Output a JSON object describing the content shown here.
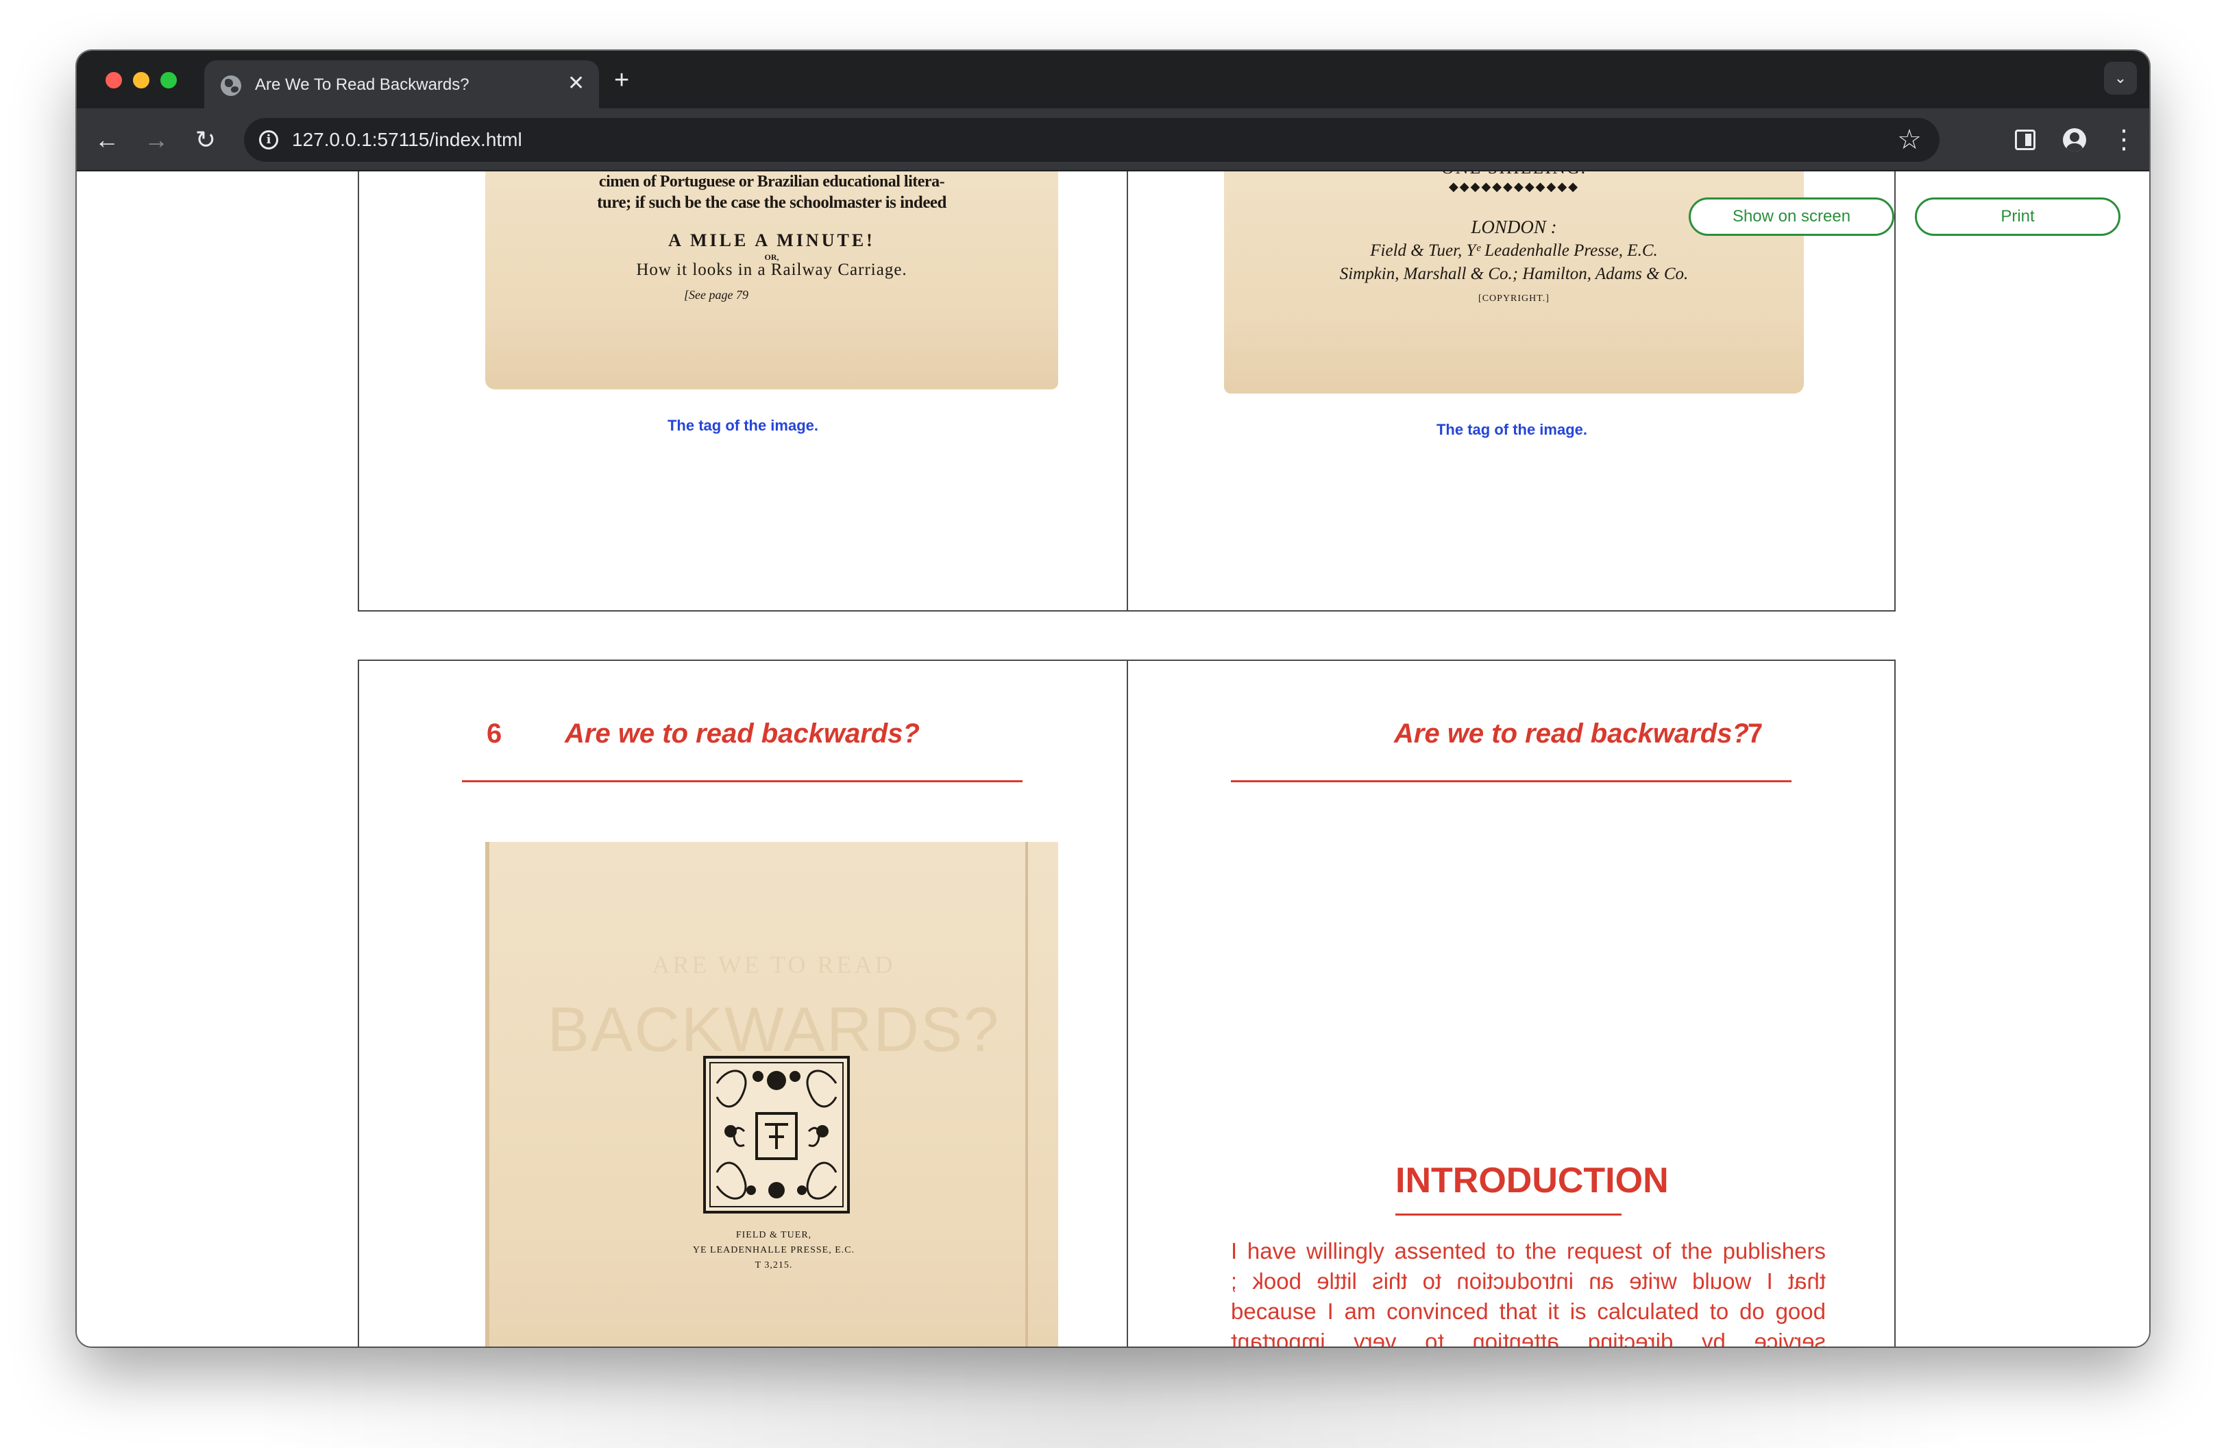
{
  "browser": {
    "tab_title": "Are We To Read Backwards?",
    "tab_close": "✕",
    "new_tab": "+",
    "tab_menu": "⌄",
    "url": "127.0.0.1:57115/index.html",
    "back": "←",
    "forward": "→",
    "reload": "↻",
    "info": "i",
    "star": "☆",
    "menu": "⋮"
  },
  "actions": {
    "show_on_screen": "Show on screen",
    "print": "Print"
  },
  "spread1": {
    "left_scan": {
      "lines": [
        "cimen of Portuguese or Brazilian educational litera-",
        "ture; if such be the case the schoolmaster is indeed",
        "A MILE A MINUTE!",
        "OR,",
        "How it looks in a Railway Carriage.",
        "[See page 79"
      ]
    },
    "right_scan": {
      "lines": [
        "ONE SHILLING.",
        "◆◆◆◆◆◆◆◆◆◆◆◆",
        "LONDON :",
        "Field & Tuer, Yᵉ Leadenhalle Presse, E.C.",
        "Simpkin, Marshall & Co.; Hamilton, Adams & Co.",
        "[COPYRIGHT.]"
      ]
    },
    "left_caption": "The tag of the image.",
    "right_caption": "The tag of the image."
  },
  "spread2": {
    "left": {
      "page_number": "6",
      "running_title": "Are we to read backwards?",
      "scan": {
        "ghost_small": "ARE WE TO READ",
        "ghost_large": "BACKWARDS?",
        "publisher_lines": [
          "FIELD & TUER,",
          "YE LEADENHALLE PRESSE, E.C.",
          "T 3,215."
        ]
      }
    },
    "right": {
      "page_number": "7",
      "running_title": "Are we to read backwards?",
      "heading": "INTRODUCTION",
      "lines": [
        "I have willingly assented to the request of the publishers",
        "that I would write an introduction to this little book ;",
        "because I am convinced that it is calculated to do good",
        "service by directing attention to very important"
      ]
    }
  }
}
